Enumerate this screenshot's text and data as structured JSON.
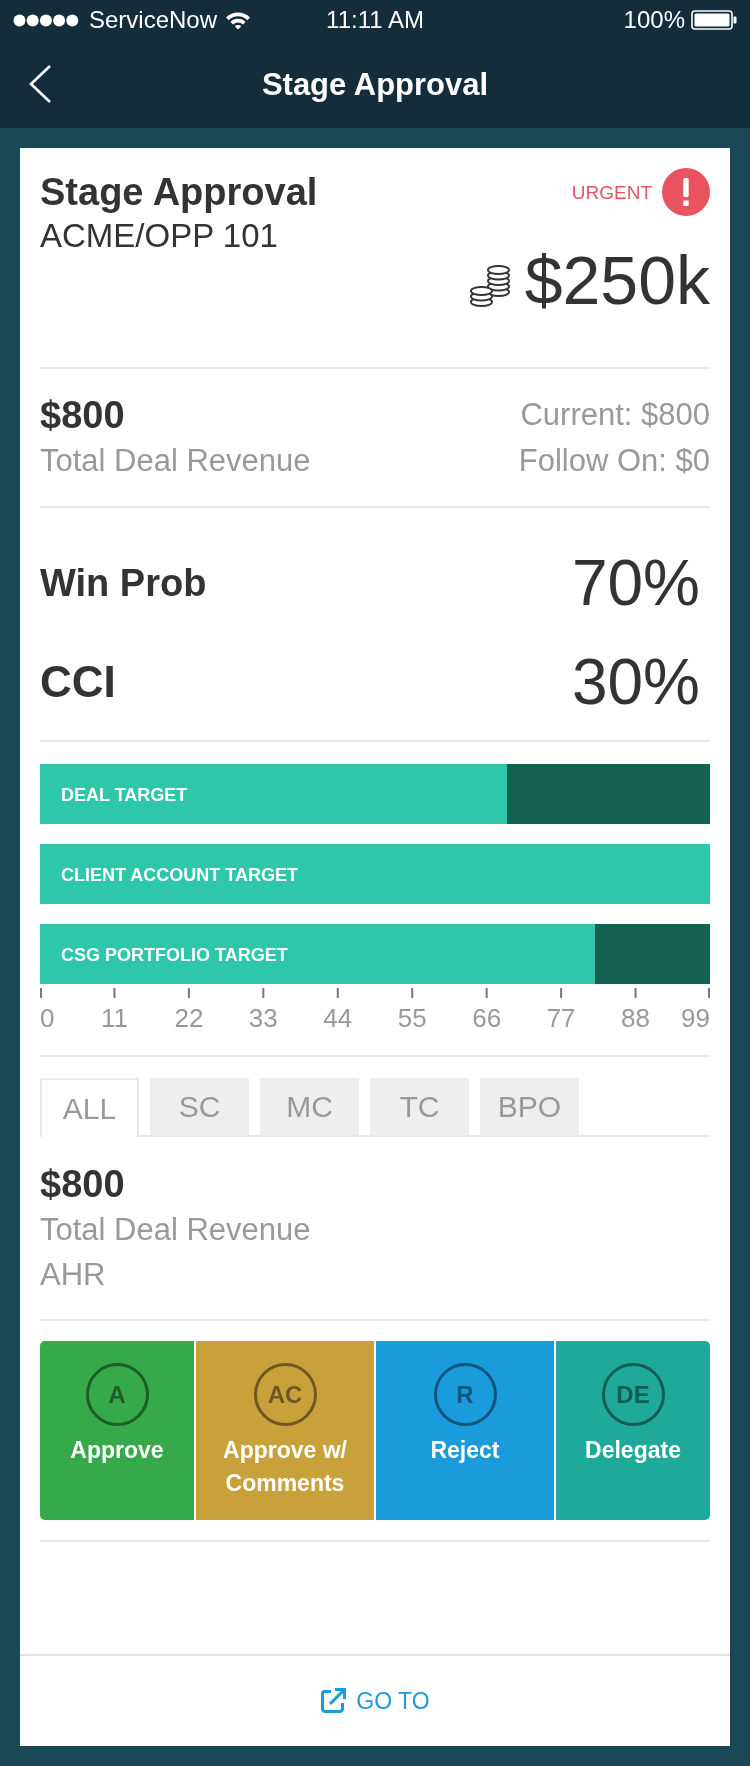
{
  "status_bar": {
    "carrier": "ServiceNow",
    "time": "11:11 AM",
    "battery": "100%"
  },
  "nav_bar": {
    "title": "Stage Approval"
  },
  "header": {
    "title": "Stage Approval",
    "subtitle": "ACME/OPP 101",
    "priority": "URGENT",
    "amount": "$250k"
  },
  "revenue": {
    "amount": "$800",
    "label": "Total Deal Revenue",
    "current": "Current: $800",
    "follow_on": "Follow On: $0"
  },
  "metrics": [
    {
      "kind": "normal",
      "label": "Win Prob",
      "value": "70%"
    },
    {
      "kind": "large",
      "label": "CCI",
      "value": "30%"
    }
  ],
  "targets": {
    "chart_data": {
      "type": "bar",
      "orientation": "horizontal",
      "stacked": true,
      "categories": [
        "DEAL TARGET",
        "CLIENT ACCOUNT TARGET",
        "CSG PORTFOLIO TARGET"
      ],
      "series": [
        {
          "color": "#2fc7a9",
          "values": [
            69,
            99,
            82
          ]
        },
        {
          "color": "#146152",
          "values": [
            30,
            0,
            17
          ]
        }
      ],
      "xlim": [
        0,
        99
      ],
      "xticks": [
        0,
        11,
        22,
        33,
        44,
        55,
        66,
        77,
        88,
        99
      ]
    }
  },
  "tabs": [
    {
      "label": "ALL",
      "selected": true
    },
    {
      "label": "SC",
      "selected": false
    },
    {
      "label": "MC",
      "selected": false
    },
    {
      "label": "TC",
      "selected": false
    },
    {
      "label": "BPO",
      "selected": false
    }
  ],
  "tab_content": {
    "amount": "$800",
    "label": "Total Deal Revenue",
    "segment": "AHR"
  },
  "actions": [
    {
      "initials": "A",
      "label": "Approve",
      "color": "#36a94a"
    },
    {
      "initials": "AC",
      "label": "Approve w/ Comments",
      "color": "#c9a13a"
    },
    {
      "initials": "R",
      "label": "Reject",
      "color": "#1a9bdc"
    },
    {
      "initials": "DE",
      "label": "Delegate",
      "color": "#1fa99a"
    }
  ],
  "footer": {
    "link": "GO TO"
  }
}
